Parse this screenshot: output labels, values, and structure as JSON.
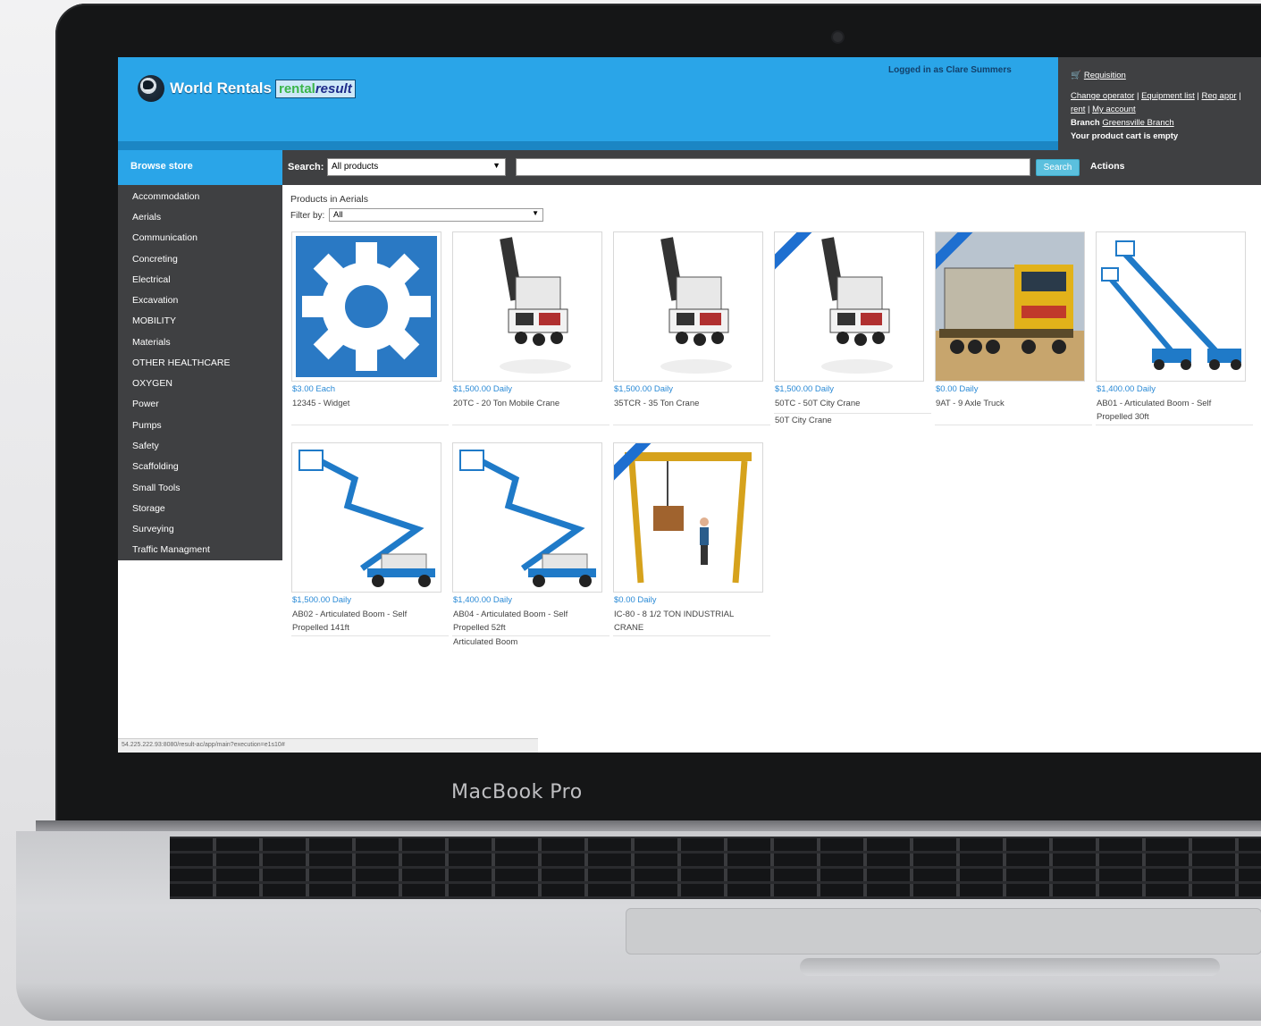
{
  "device": {
    "brand": "MacBook Pro"
  },
  "header": {
    "logo_text": "World Rentals",
    "logo_rental": "rental",
    "logo_result": "result",
    "logged_in": "Logged in as Clare Summers"
  },
  "account": {
    "requisition": "Requisition",
    "change_operator": "Change operator",
    "equipment_list": "Equipment list",
    "req_appr": "Req appr",
    "rent": "rent",
    "my_account": "My account",
    "branch_label": "Branch",
    "branch_value": "Greensville Branch",
    "cart_status": "Your product cart is empty"
  },
  "toolbar": {
    "browse_store": "Browse store",
    "search_label": "Search:",
    "search_scope": "All products",
    "search_button": "Search",
    "actions": "Actions"
  },
  "sidebar": {
    "items": [
      "Accommodation",
      "Aerials",
      "Communication",
      "Concreting",
      "Electrical",
      "Excavation",
      "MOBILITY",
      "Materials",
      "OTHER HEALTHCARE",
      "OXYGEN",
      "Power",
      "Pumps",
      "Safety",
      "Scaffolding",
      "Small Tools",
      "Storage",
      "Surveying",
      "Traffic Managment"
    ]
  },
  "main": {
    "title": "Products in Aerials",
    "filter_label": "Filter by:",
    "filter_value": "All"
  },
  "products": [
    {
      "price": "$3.00 Each",
      "name": "12345 - Widget"
    },
    {
      "price": "$1,500.00 Daily",
      "name": "20TC - 20 Ton Mobile Crane"
    },
    {
      "price": "$1,500.00 Daily",
      "name": "35TCR - 35 Ton Crane"
    },
    {
      "price": "$1,500.00 Daily",
      "name": "50TC - 50T City Crane",
      "extra": "50T City Crane"
    },
    {
      "price": "$0.00 Daily",
      "name": "9AT - 9 Axle Truck"
    },
    {
      "price": "$1,400.00 Daily",
      "name": "AB01 - Articulated Boom - Self Propelled 30ft"
    },
    {
      "price": "$1,500.00 Daily",
      "name": "AB02 - Articulated Boom - Self Propelled 141ft"
    },
    {
      "price": "$1,400.00 Daily",
      "name": "AB04 - Articulated Boom - Self Propelled 52ft",
      "extra": "Articulated Boom"
    },
    {
      "price": "$0.00 Daily",
      "name": "IC-80 - 8 1/2 TON INDUSTRIAL CRANE"
    }
  ],
  "status_bar": {
    "url": "54.225.222.93:8080/result-ac/app/main?execution=e1s10#"
  },
  "colors": {
    "header_blue": "#2aa5e8",
    "panel_dark": "#3f4042",
    "price_blue": "#2a8ad6",
    "search_btn": "#5bc0de"
  }
}
